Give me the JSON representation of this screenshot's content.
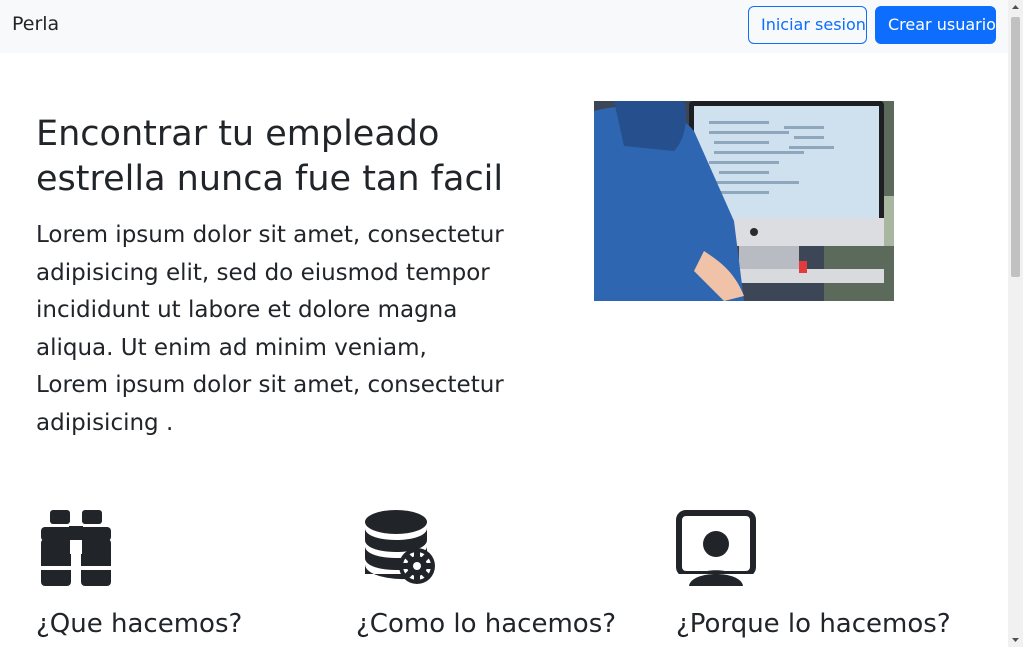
{
  "navbar": {
    "brand": "Perla",
    "login_label": "Iniciar sesion",
    "register_label": "Crear usuario"
  },
  "hero": {
    "title": "Encontrar tu empleado estrella nunca fue tan facil",
    "text": "Lorem ipsum dolor sit amet, consectetur adipisicing elit, sed do eiusmod tempor incididunt ut labore et dolore magna aliqua. Ut enim ad minim veniam, Lorem ipsum dolor sit amet, consectetur adipisicing .",
    "image": "person-at-imac-coding-photo"
  },
  "features": [
    {
      "icon": "binoculars-icon",
      "title": "¿Que hacemos?"
    },
    {
      "icon": "database-gear-icon",
      "title": "¿Como lo hacemos?"
    },
    {
      "icon": "person-video-icon",
      "title": "¿Porque lo hacemos?"
    }
  ],
  "colors": {
    "primary": "#0d6efd",
    "navbar_bg": "#f8f9fa",
    "text": "#212529"
  }
}
